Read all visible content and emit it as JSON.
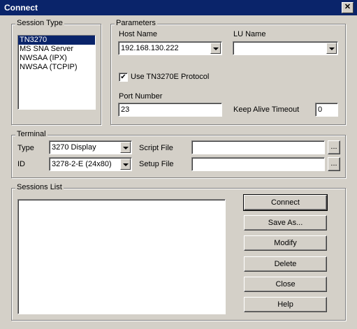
{
  "window": {
    "title": "Connect",
    "close_glyph": "✕"
  },
  "session_type": {
    "legend": "Session Type",
    "items": [
      "TN3270",
      "MS SNA Server",
      "NWSAA (IPX)",
      "NWSAA (TCPIP)"
    ],
    "selected_index": 0
  },
  "parameters": {
    "legend": "Parameters",
    "host_name_label": "Host Name",
    "host_name_value": "192.168.130.222",
    "lu_name_label": "LU Name",
    "lu_name_value": "",
    "use_tn3270e_label": "Use TN3270E Protocol",
    "use_tn3270e_checked": true,
    "port_number_label": "Port Number",
    "port_number_value": "23",
    "keep_alive_label": "Keep Alive Timeout",
    "keep_alive_value": "0"
  },
  "terminal": {
    "legend": "Terminal",
    "type_label": "Type",
    "type_value": "3270 Display",
    "id_label": "ID",
    "id_value": "3278-2-E (24x80)",
    "script_file_label": "Script File",
    "script_file_value": "",
    "setup_file_label": "Setup File",
    "setup_file_value": "",
    "browse_label": "..."
  },
  "sessions_list": {
    "legend": "Sessions List",
    "items": []
  },
  "buttons": {
    "connect": "Connect",
    "save_as": "Save As...",
    "modify": "Modify",
    "delete": "Delete",
    "close": "Close",
    "help": "Help"
  }
}
